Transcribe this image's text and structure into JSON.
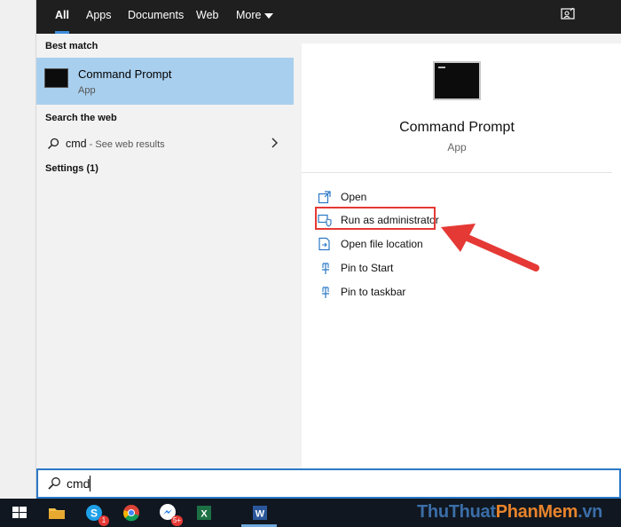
{
  "tabs": [
    {
      "label": "All"
    },
    {
      "label": "Apps"
    },
    {
      "label": "Documents"
    },
    {
      "label": "Web"
    },
    {
      "label": "More"
    }
  ],
  "left": {
    "best_match_heading": "Best match",
    "best_match": {
      "title": "Command Prompt",
      "subtitle": "App"
    },
    "search_web_heading": "Search the web",
    "web_result": {
      "query": "cmd",
      "hint": " - See web results"
    },
    "settings_heading": "Settings (1)"
  },
  "right": {
    "app_title": "Command Prompt",
    "app_subtitle": "App",
    "actions": [
      {
        "label": "Open",
        "icon": "open-icon"
      },
      {
        "label": "Run as administrator",
        "icon": "shield-admin-icon"
      },
      {
        "label": "Open file location",
        "icon": "file-location-icon"
      },
      {
        "label": "Pin to Start",
        "icon": "pin-icon"
      },
      {
        "label": "Pin to taskbar",
        "icon": "pin-icon"
      }
    ]
  },
  "search": {
    "value": "cmd"
  },
  "taskbar": {
    "icons": [
      "windows-start-icon",
      "file-explorer-icon",
      "skype-icon",
      "chrome-icon",
      "messenger-icon",
      "excel-icon",
      "word-icon"
    ],
    "skype_badge": "1",
    "messenger_badge": "5+"
  },
  "watermark": {
    "part1": "ThuThuat",
    "part2": "PhanMem",
    "part3": ".vn"
  },
  "colors": {
    "accent": "#2b78c6",
    "selection": "#a9cfee",
    "highlight": "#e53935",
    "topbar": "#1f1f1f"
  }
}
